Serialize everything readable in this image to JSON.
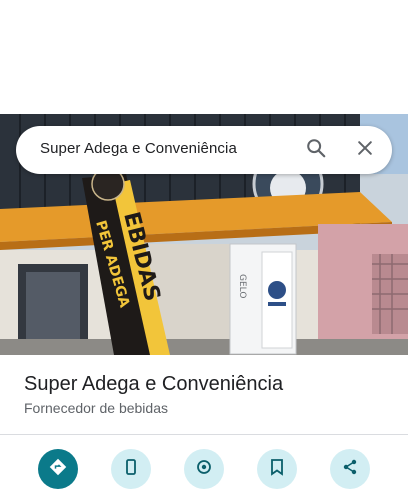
{
  "search": {
    "query": "Super Adega e Conveniência"
  },
  "photo": {
    "banner_text_line1": "PER ADEGA",
    "banner_text_line2": "EBIDAS",
    "freezer_label": "GELO"
  },
  "place": {
    "name": "Super Adega e Conveniência",
    "category": "Fornecedor de bebidas"
  },
  "colors": {
    "primary_action": "#0b7a8a",
    "secondary_action": "#d2eef3",
    "title_text": "#202124",
    "subtitle_text": "#5f6368"
  },
  "actions": [
    {
      "icon": "directions-icon"
    },
    {
      "icon": "phone-icon"
    },
    {
      "icon": "location-icon"
    },
    {
      "icon": "save-icon"
    },
    {
      "icon": "share-icon"
    }
  ]
}
